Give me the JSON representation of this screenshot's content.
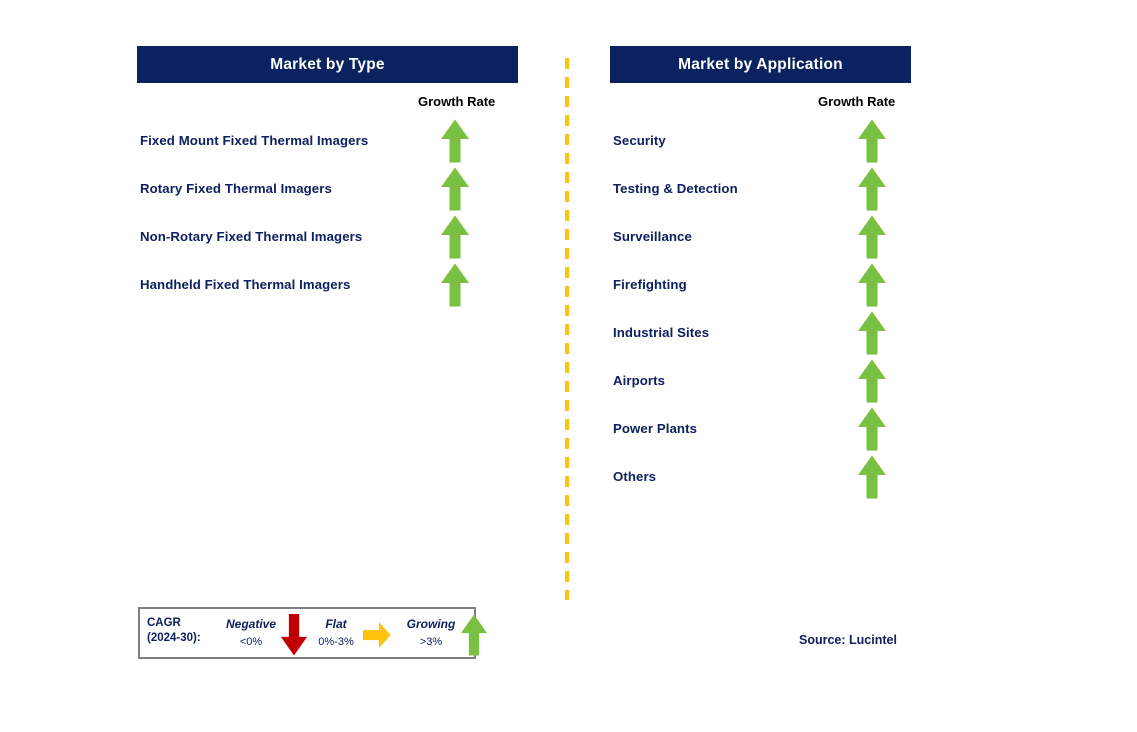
{
  "panels": [
    {
      "id": "type",
      "title": "Market by Type",
      "growth_label": "Growth Rate",
      "rows": [
        {
          "label": "Fixed Mount Fixed Thermal Imagers",
          "trend": "growing"
        },
        {
          "label": "Rotary Fixed Thermal Imagers",
          "trend": "growing"
        },
        {
          "label": "Non-Rotary Fixed Thermal Imagers",
          "trend": "growing"
        },
        {
          "label": "Handheld Fixed Thermal Imagers",
          "trend": "growing"
        }
      ]
    },
    {
      "id": "application",
      "title": "Market by Application",
      "growth_label": "Growth Rate",
      "rows": [
        {
          "label": "Security",
          "trend": "growing"
        },
        {
          "label": "Testing & Detection",
          "trend": "growing"
        },
        {
          "label": "Surveillance",
          "trend": "growing"
        },
        {
          "label": "Firefighting",
          "trend": "growing"
        },
        {
          "label": "Industrial Sites",
          "trend": "growing"
        },
        {
          "label": "Airports",
          "trend": "growing"
        },
        {
          "label": "Power Plants",
          "trend": "growing"
        },
        {
          "label": "Others",
          "trend": "growing"
        }
      ]
    }
  ],
  "legend": {
    "cagr_line1": "CAGR",
    "cagr_line2": "(2024-30):",
    "items": [
      {
        "title": "Negative",
        "value": "<0%",
        "icon": "down-arrow-icon",
        "color": "#c00000"
      },
      {
        "title": "Flat",
        "value": "0%-3%",
        "icon": "right-arrow-icon",
        "color": "#ffc20e"
      },
      {
        "title": "Growing",
        "value": ">3%",
        "icon": "up-arrow-icon",
        "color": "#7ac143"
      }
    ]
  },
  "source": "Source: Lucintel",
  "colors": {
    "header_navy": "#0a2360",
    "text_navy": "#0f2060",
    "green": "#7ac143",
    "red": "#c00000",
    "amber": "#ffc20e",
    "divider": "#ffc20e",
    "legend_border": "#7f7f7f"
  }
}
